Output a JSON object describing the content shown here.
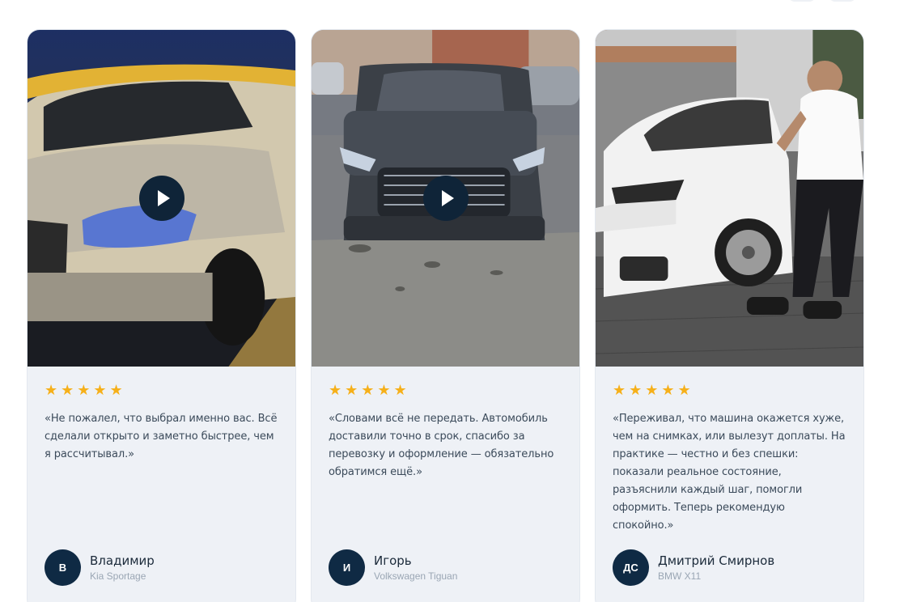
{
  "reviews": [
    {
      "rating": 5,
      "quote": "«Не пожалел, что выбрал именно вас. Всё сделали открыто и заметно быстрее, чем я рассчитывал.»",
      "initials": "В",
      "name": "Владимир",
      "car": "Kia Sportage",
      "media": "video",
      "stars": "★★★★★"
    },
    {
      "rating": 5,
      "quote": "«Словами всё не передать. Автомобиль доставили точно в срок, спасибо за перевозку и оформление — обязательно обратимся ещё.»",
      "initials": "И",
      "name": "Игорь",
      "car": "Volkswagen Tiguan",
      "media": "video",
      "stars": "★★★★★"
    },
    {
      "rating": 5,
      "quote": "«Переживал, что машина окажется хуже, чем на снимках, или вылезут доплаты. На практике — честно и без спешки: показали реальное состояние, разъяснили каждый шаг, помогли оформить. Теперь рекомендую спокойно.»",
      "initials": "ДС",
      "name": "Дмитрий Смирнов",
      "car": "BMW X11",
      "media": "photo",
      "stars": "★★★★★"
    }
  ],
  "colors": {
    "card_bg": "#eef1f6",
    "star": "#f6b01a",
    "avatar_bg": "#0f2a44",
    "play_button": "#0f2438"
  }
}
